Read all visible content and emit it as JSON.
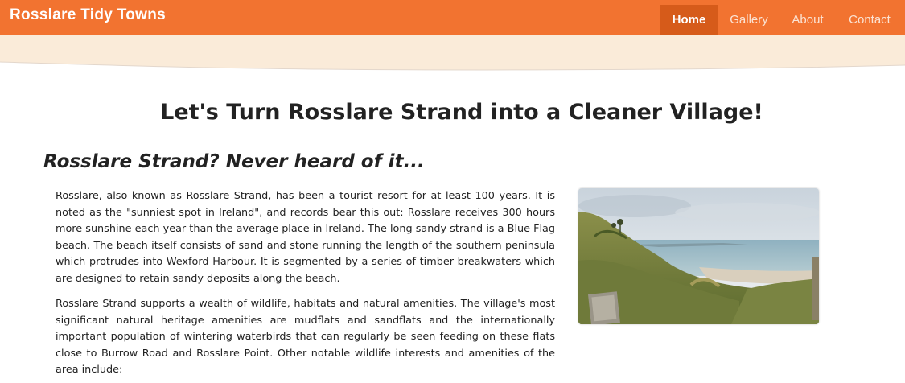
{
  "navbar": {
    "brand": "Rosslare Tidy Towns",
    "items": [
      {
        "label": "Home",
        "active": true
      },
      {
        "label": "Gallery",
        "active": false
      },
      {
        "label": "About",
        "active": false
      },
      {
        "label": "Contact",
        "active": false
      }
    ]
  },
  "colors": {
    "navbar_bg": "#f27330",
    "active_item_bg": "#d65b1a",
    "band_bg": "#faebd9"
  },
  "main": {
    "headline": "Let's Turn Rosslare Strand into a Cleaner Village!",
    "section_title": "Rosslare Strand? Never heard of it...",
    "paragraphs": [
      "Rosslare, also known as Rosslare Strand, has been a tourist resort for at least 100 years. It is noted as the \"sunniest spot in Ireland\", and records bear this out: Rosslare receives 300 hours more sunshine each year than the average place in Ireland. The long sandy strand is a Blue Flag beach. The beach itself consists of sand and stone running the length of the southern peninsula which protrudes into Wexford Harbour. It is segmented by a series of timber breakwaters which are designed to retain sandy deposits along the beach.",
      "Rosslare Strand supports a wealth of wildlife, habitats and natural amenities. The village's most significant natural heritage amenities are mudflats and sandflats and the internationally important population of wintering waterbirds that can regularly be seen feeding on these flats close to Burrow Road and Rosslare Point. Other notable wildlife interests and amenities of the area include:"
    ]
  }
}
